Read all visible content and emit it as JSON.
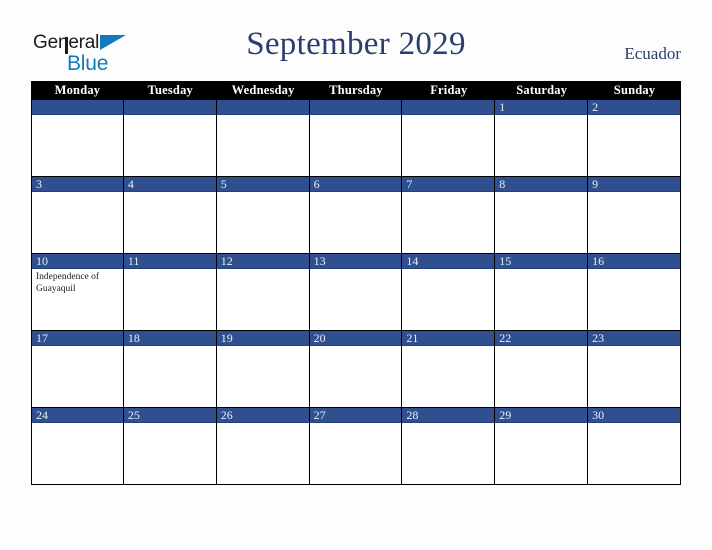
{
  "branding": {
    "logo_primary": "General",
    "logo_secondary": "Blue",
    "logo_triangle_color": "#1279be",
    "logo_primary_color": "#1b1b1b"
  },
  "header": {
    "title": "September 2029",
    "country": "Ecuador",
    "title_color": "#2c3e6e"
  },
  "calendar": {
    "month": "September",
    "year": "2029",
    "weekday_headers": [
      "Monday",
      "Tuesday",
      "Wednesday",
      "Thursday",
      "Friday",
      "Saturday",
      "Sunday"
    ],
    "header_bg": "#000000",
    "header_text_color": "#ffffff",
    "day_band_color": "#2f4f8e",
    "day_number_color": "#e9eef7",
    "cell_bg": "#ffffff",
    "weeks": [
      [
        {
          "day": "",
          "events": []
        },
        {
          "day": "",
          "events": []
        },
        {
          "day": "",
          "events": []
        },
        {
          "day": "",
          "events": []
        },
        {
          "day": "",
          "events": []
        },
        {
          "day": "1",
          "events": []
        },
        {
          "day": "2",
          "events": []
        }
      ],
      [
        {
          "day": "3",
          "events": []
        },
        {
          "day": "4",
          "events": []
        },
        {
          "day": "5",
          "events": []
        },
        {
          "day": "6",
          "events": []
        },
        {
          "day": "7",
          "events": []
        },
        {
          "day": "8",
          "events": []
        },
        {
          "day": "9",
          "events": []
        }
      ],
      [
        {
          "day": "10",
          "events": [
            "Independence of Guayaquil"
          ]
        },
        {
          "day": "11",
          "events": []
        },
        {
          "day": "12",
          "events": []
        },
        {
          "day": "13",
          "events": []
        },
        {
          "day": "14",
          "events": []
        },
        {
          "day": "15",
          "events": []
        },
        {
          "day": "16",
          "events": []
        }
      ],
      [
        {
          "day": "17",
          "events": []
        },
        {
          "day": "18",
          "events": []
        },
        {
          "day": "19",
          "events": []
        },
        {
          "day": "20",
          "events": []
        },
        {
          "day": "21",
          "events": []
        },
        {
          "day": "22",
          "events": []
        },
        {
          "day": "23",
          "events": []
        }
      ],
      [
        {
          "day": "24",
          "events": []
        },
        {
          "day": "25",
          "events": []
        },
        {
          "day": "26",
          "events": []
        },
        {
          "day": "27",
          "events": []
        },
        {
          "day": "28",
          "events": []
        },
        {
          "day": "29",
          "events": []
        },
        {
          "day": "30",
          "events": []
        }
      ]
    ]
  }
}
